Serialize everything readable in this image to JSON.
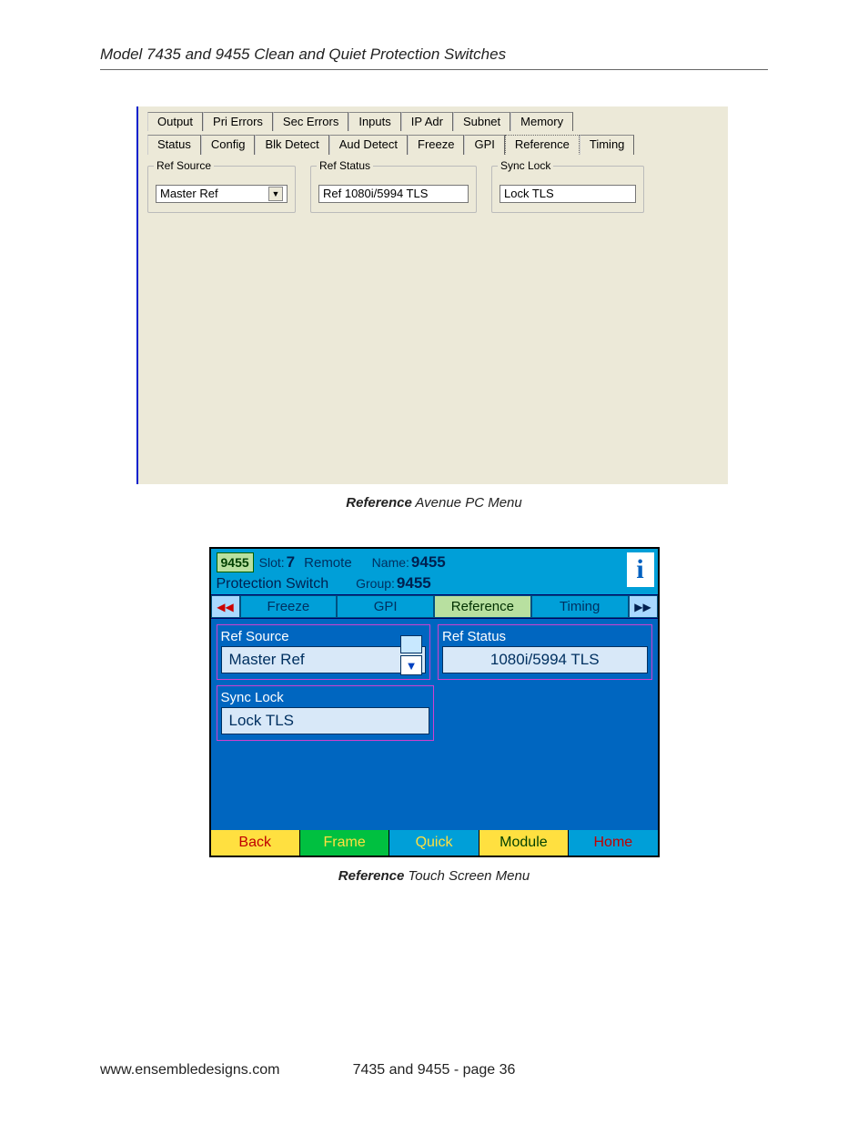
{
  "doc": {
    "title": "Model 7435 and 9455 Clean and Quiet Protection Switches",
    "caption1_bold": "Reference",
    "caption1_rest": " Avenue PC Menu",
    "caption2_bold": "Reference",
    "caption2_rest": " Touch Screen Menu",
    "footer_left": "www.ensembledesigns.com",
    "footer_mid": "7435 and 9455 - page 36"
  },
  "win": {
    "tabs_row1": [
      "Output",
      "Pri Errors",
      "Sec Errors",
      "Inputs",
      "IP Adr",
      "Subnet",
      "Memory"
    ],
    "tabs_row2": [
      "Status",
      "Config",
      "Blk Detect",
      "Aud Detect",
      "Freeze",
      "GPI",
      "Reference",
      "Timing"
    ],
    "active_tab": "Reference",
    "groups": {
      "ref_source": {
        "label": "Ref Source",
        "value": "Master Ref"
      },
      "ref_status": {
        "label": "Ref Status",
        "value": "Ref 1080i/5994 TLS"
      },
      "sync_lock": {
        "label": "Sync Lock",
        "value": "Lock TLS"
      }
    }
  },
  "ts": {
    "header": {
      "model": "9455",
      "slot_label": "Slot:",
      "slot_value": "7",
      "mode": "Remote",
      "name_label": "Name:",
      "name_value": "9455",
      "subtitle": "Protection Switch",
      "group_label": "Group:",
      "group_value": "9455",
      "info_icon_text": "i"
    },
    "nav_left": "◀◀",
    "nav_right": "▶▶",
    "tabs": [
      "Freeze",
      "GPI",
      "Reference",
      "Timing"
    ],
    "active_tab": "Reference",
    "fields": {
      "ref_source": {
        "label": "Ref Source",
        "value": "Master Ref"
      },
      "ref_status": {
        "label": "Ref Status",
        "value": "1080i/5994 TLS"
      },
      "sync_lock": {
        "label": "Sync Lock",
        "value": "Lock TLS"
      }
    },
    "dd_arrow": "▼",
    "buttons": {
      "back": "Back",
      "frame": "Frame",
      "quick": "Quick",
      "module": "Module",
      "home": "Home"
    }
  }
}
